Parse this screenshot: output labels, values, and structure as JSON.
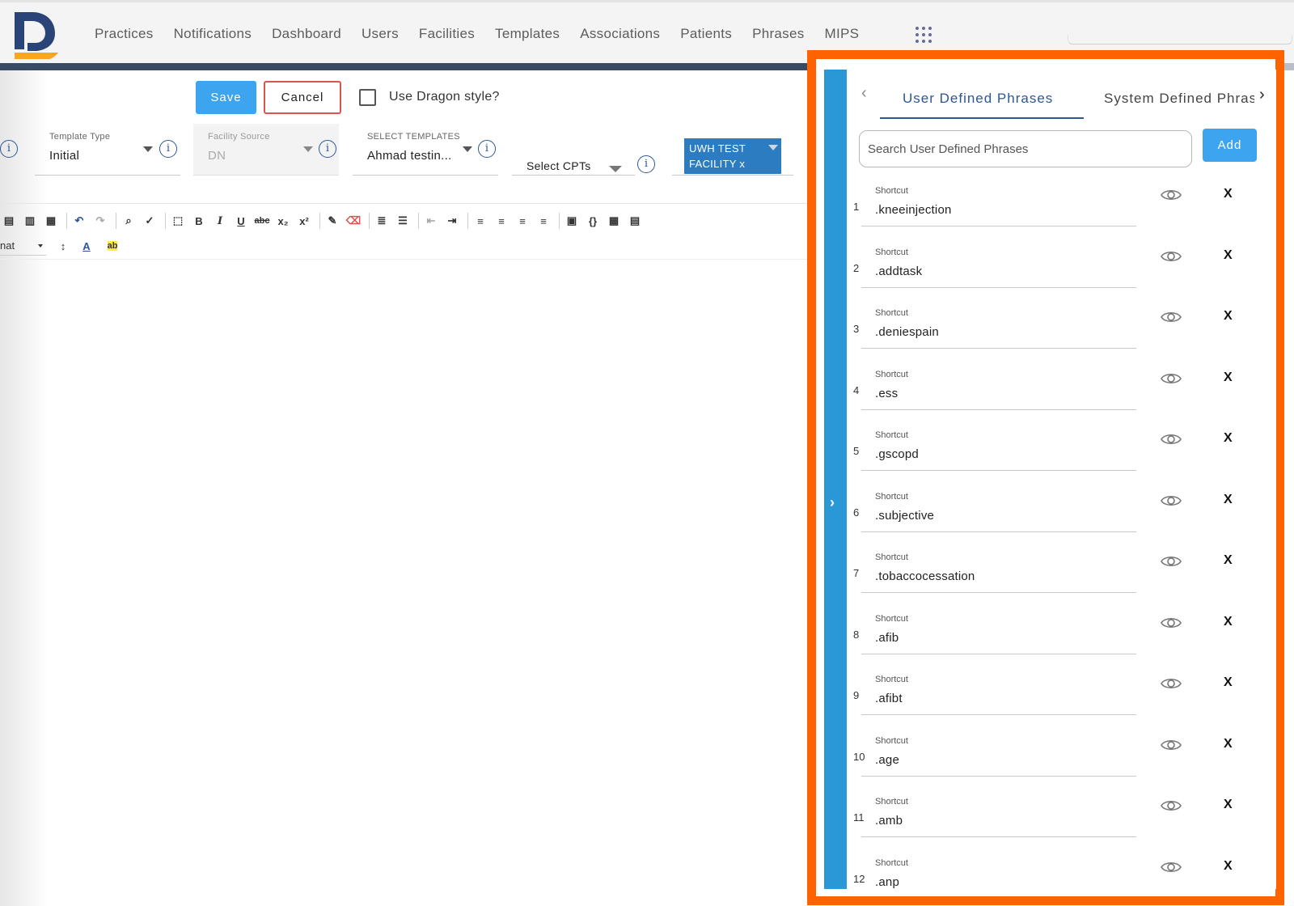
{
  "nav": {
    "items": [
      "Practices",
      "Notifications",
      "Dashboard",
      "Users",
      "Facilities",
      "Templates",
      "Associations",
      "Patients",
      "Phrases",
      "MIPS"
    ]
  },
  "actions": {
    "save_label": "Save",
    "cancel_label": "Cancel",
    "dragon_label": "Use Dragon style?"
  },
  "form": {
    "template_type_label": "Template Type",
    "template_type_value": "Initial",
    "facility_source_label": "Facility Source",
    "facility_source_value": "DN",
    "select_templates_label": "SELECT TEMPLATES",
    "select_templates_value": "Ahmad testin...",
    "select_cpts_label": "Select CPTs",
    "facility_chip_line1": "UWH TEST",
    "facility_chip_line2": "FACILITY  x",
    "info_glyph": "i"
  },
  "editor": {
    "format_label": "nat"
  },
  "phrases_panel": {
    "tab_active": "User Defined Phrases",
    "tab_other": "System Defined Phrases",
    "search_placeholder": "Search User Defined Phrases",
    "add_label": "Add",
    "shortcut_label": "Shortcut",
    "delete_glyph": "X",
    "rows": [
      {
        "num": "1",
        "shortcut": ".kneeinjection"
      },
      {
        "num": "2",
        "shortcut": ".addtask"
      },
      {
        "num": "3",
        "shortcut": ".deniespain"
      },
      {
        "num": "4",
        "shortcut": ".ess"
      },
      {
        "num": "5",
        "shortcut": ".gscopd"
      },
      {
        "num": "6",
        "shortcut": ".subjective"
      },
      {
        "num": "7",
        "shortcut": ".tobaccocessation"
      },
      {
        "num": "8",
        "shortcut": ".afib"
      },
      {
        "num": "9",
        "shortcut": ".afibt"
      },
      {
        "num": "10",
        "shortcut": ".age"
      },
      {
        "num": "11",
        "shortcut": ".amb"
      },
      {
        "num": "12",
        "shortcut": ".anp"
      }
    ]
  },
  "colors": {
    "accent_blue": "#3da5f0",
    "panel_highlight": "#ff6200",
    "panel_strip": "#2a97d6",
    "link_blue": "#2b5797"
  }
}
